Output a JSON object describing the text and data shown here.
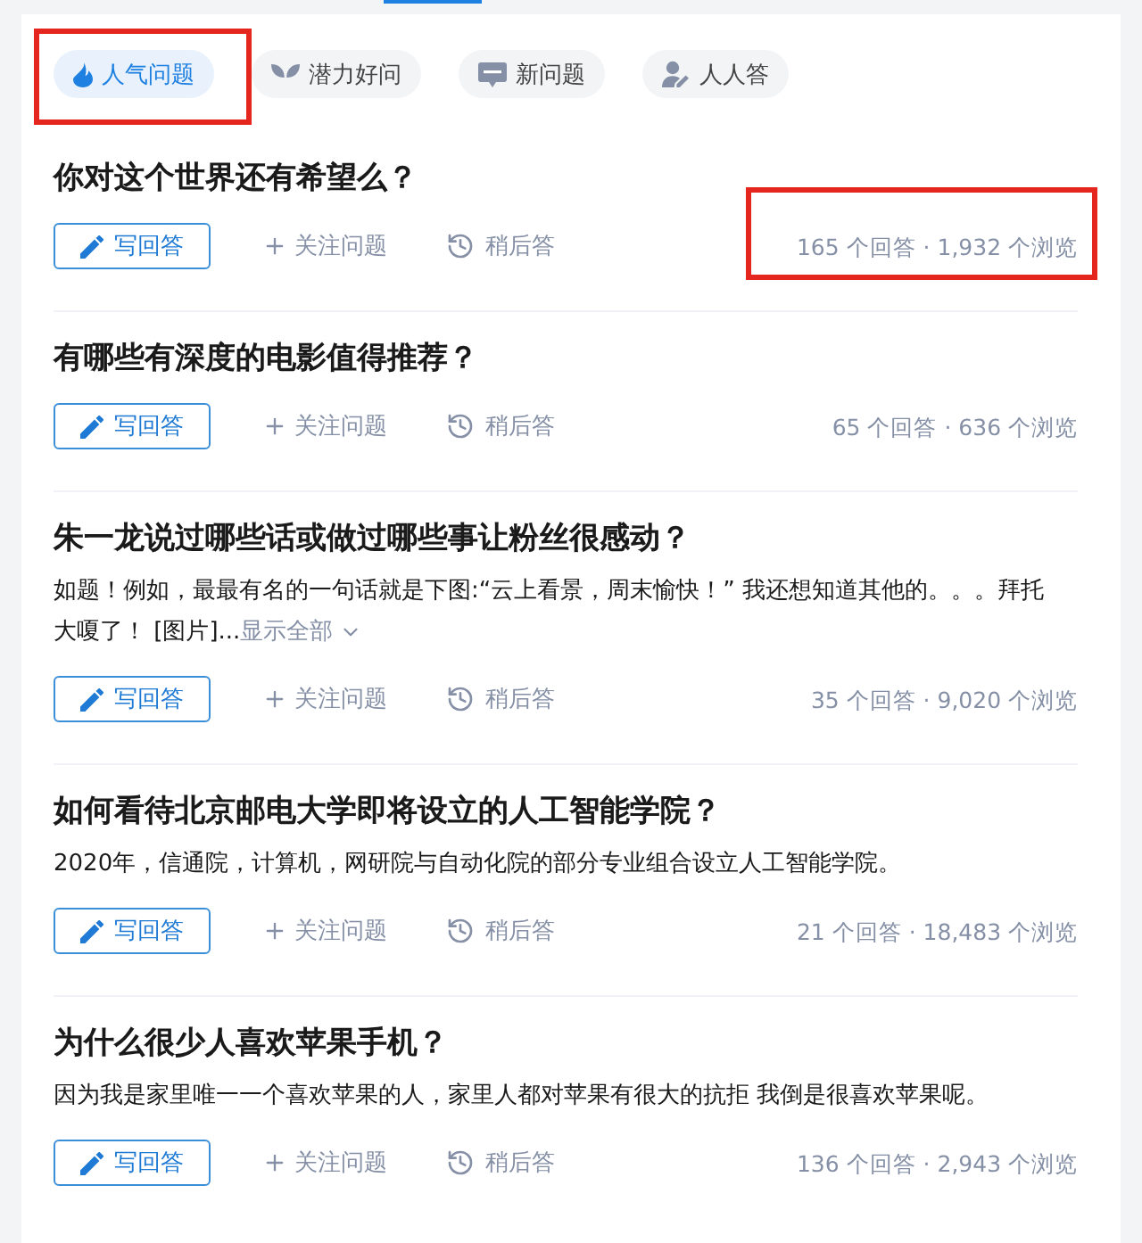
{
  "tabs": [
    {
      "label": "人气问题",
      "selected": true,
      "highlighted": true
    },
    {
      "label": "潜力好问",
      "selected": false,
      "highlighted": false
    },
    {
      "label": "新问题",
      "selected": false,
      "highlighted": false
    },
    {
      "label": "人人答",
      "selected": false,
      "highlighted": false
    }
  ],
  "questions": [
    {
      "title": "你对这个世界还有希望么？",
      "actions": [
        {
          "kind": "answer",
          "label": "写回答"
        },
        {
          "kind": "follow",
          "label": "关注问题"
        },
        {
          "kind": "later",
          "label": "稍后答"
        }
      ],
      "stats": "165 个回答 · 1,932 个浏览",
      "stats_highlighted": true
    },
    {
      "title": "有哪些有深度的电影值得推荐？",
      "actions": [
        {
          "kind": "answer",
          "label": "写回答"
        },
        {
          "kind": "follow",
          "label": "关注问题"
        },
        {
          "kind": "later",
          "label": "稍后答"
        }
      ],
      "stats": "65 个回答 · 636 个浏览",
      "stats_highlighted": false
    },
    {
      "title": "朱一龙说过哪些话或做过哪些事让粉丝很感动？",
      "excerpt": {
        "text": "如题！例如，最最有名的一句话就是下图:“云上看景，周末愉快！” 我还想知道其他的。。。拜托大嗄了！ [图片]...",
        "link": "显示全部"
      },
      "actions": [
        {
          "kind": "answer",
          "label": "写回答"
        },
        {
          "kind": "follow",
          "label": "关注问题"
        },
        {
          "kind": "later",
          "label": "稍后答"
        }
      ],
      "stats": "35 个回答 · 9,020 个浏览",
      "stats_highlighted": false
    },
    {
      "title": "如何看待北京邮电大学即将设立的人工智能学院？",
      "excerpt": {
        "text": "2020年，信通院，计算机，网研院与自动化院的部分专业组合设立人工智能学院。"
      },
      "actions": [
        {
          "kind": "answer",
          "label": "写回答"
        },
        {
          "kind": "follow",
          "label": "关注问题"
        },
        {
          "kind": "later",
          "label": "稍后答"
        }
      ],
      "stats": "21 个回答 · 18,483 个浏览",
      "stats_highlighted": false
    },
    {
      "title": "为什么很少人喜欢苹果手机？",
      "excerpt": {
        "text": "因为我是家里唯一一个喜欢苹果的人，家里人都对苹果有很大的抗拒 我倒是很喜欢苹果呢。"
      },
      "actions": [
        {
          "kind": "answer",
          "label": "写回答"
        },
        {
          "kind": "follow",
          "label": "关注问题"
        },
        {
          "kind": "later",
          "label": "稍后答"
        }
      ],
      "stats": "136 个回答 · 2,943 个浏览",
      "stats_highlighted": false
    }
  ]
}
